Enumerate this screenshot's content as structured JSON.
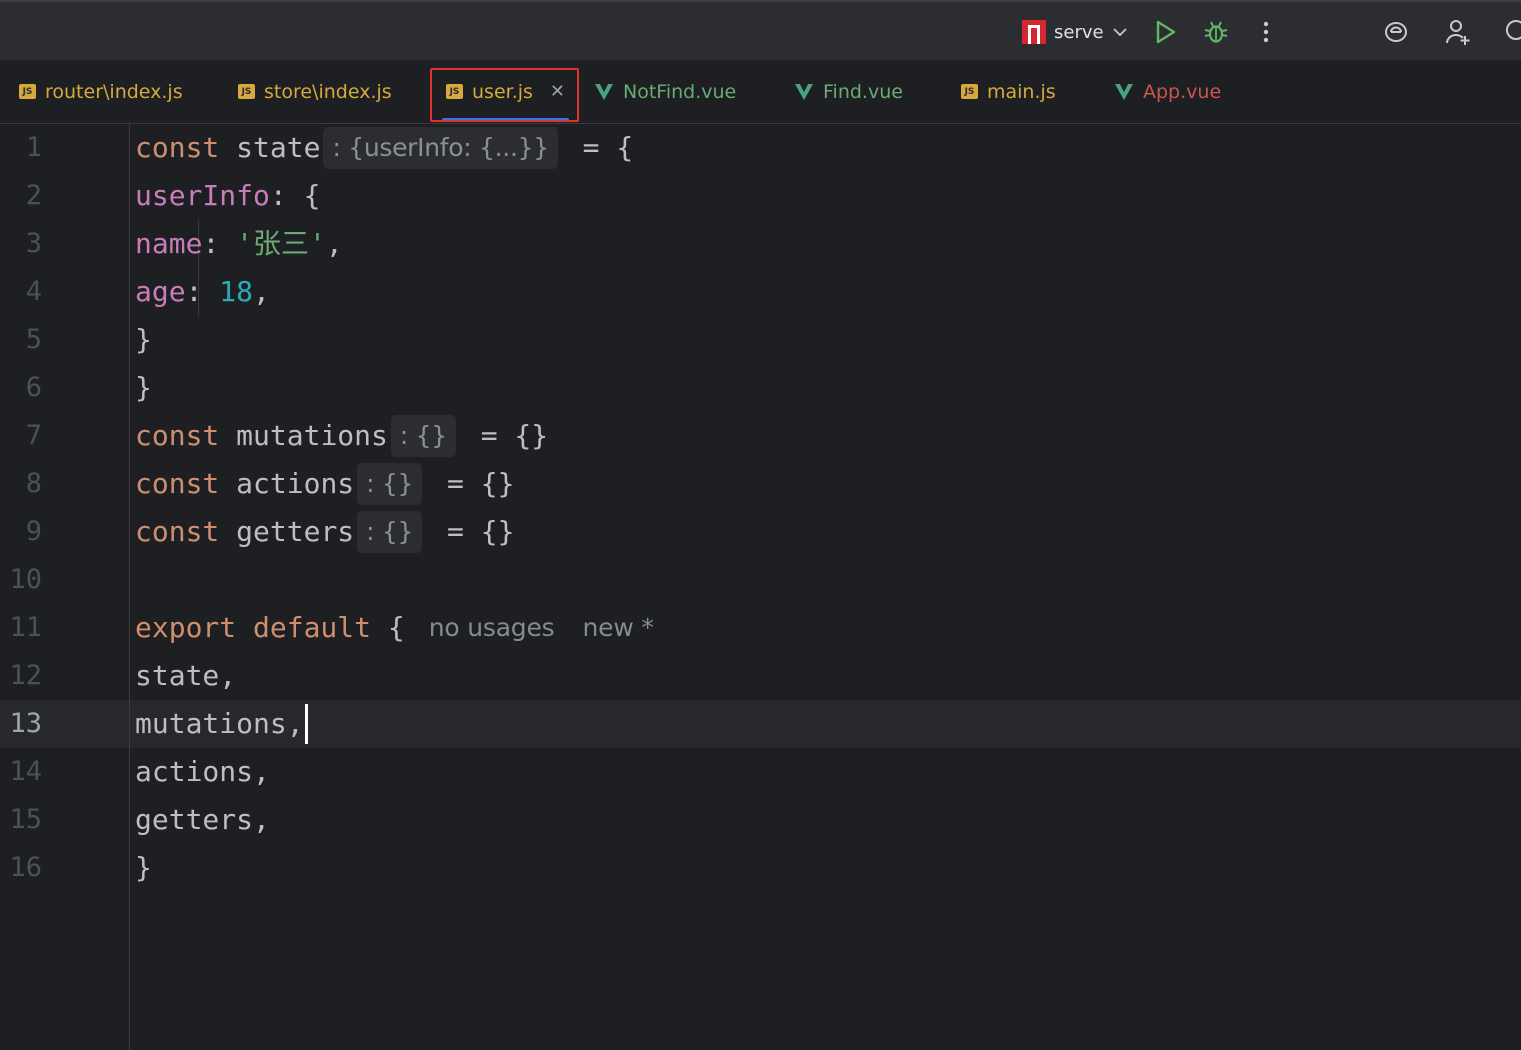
{
  "toolbar": {
    "run_config_label": "serve",
    "icons": [
      "run-config-icon",
      "chevron-down-icon",
      "run-icon",
      "debug-icon",
      "more-icon",
      "ai-assistant-icon",
      "add-user-icon",
      "search-icon"
    ],
    "colors": {
      "run": "#5fb865",
      "debug": "#5fb865",
      "config": "#d4272f"
    }
  },
  "tabs": [
    {
      "label": "router\\index.js",
      "type": "js",
      "color": "#d6a93b"
    },
    {
      "label": "store\\index.js",
      "type": "js",
      "color": "#d6a93b"
    },
    {
      "label": "user.js",
      "type": "js",
      "color": "#d6a93b",
      "active": true
    },
    {
      "label": "NotFind.vue",
      "type": "vue",
      "color": "#6aab73"
    },
    {
      "label": "Find.vue",
      "type": "vue",
      "color": "#6aab73"
    },
    {
      "label": "main.js",
      "type": "js",
      "color": "#d6a93b"
    },
    {
      "label": "App.vue",
      "type": "vue",
      "color": "#c9574b"
    }
  ],
  "editor": {
    "current_line": 13,
    "line_numbers": [
      "1",
      "2",
      "3",
      "4",
      "5",
      "6",
      "7",
      "8",
      "9",
      "10",
      "11",
      "12",
      "13",
      "14",
      "15",
      "16"
    ],
    "l1": {
      "kw": "const",
      "name": " state",
      "hint": ": {userInfo: {...}}",
      "rest": " = {"
    },
    "l2": {
      "prop": "userInfo",
      "rest": ": {"
    },
    "l3": {
      "prop": "name",
      "colon": ": ",
      "str": "'张三'",
      "rest": ","
    },
    "l4": {
      "prop": "age",
      "colon": ": ",
      "num": "18",
      "rest": ","
    },
    "l5": {
      "rest": "}"
    },
    "l6": {
      "rest": "}"
    },
    "l7": {
      "kw": "const",
      "name": " mutations",
      "hint": ": {}",
      "rest": " = {}"
    },
    "l8": {
      "kw": "const",
      "name": " actions",
      "hint": ": {}",
      "rest": " = {}"
    },
    "l9": {
      "kw": "const",
      "name": " getters",
      "hint": ": {}",
      "rest": " = {}"
    },
    "l11": {
      "kw": "export default",
      "rest": " {",
      "usages": "no usages",
      "new": "new *"
    },
    "l12": {
      "rest": "state,"
    },
    "l13": {
      "rest": "mutations,"
    },
    "l14": {
      "rest": "actions,"
    },
    "l15": {
      "rest": "getters,"
    },
    "l16": {
      "rest": "}"
    }
  },
  "colors": {
    "background": "#1e1f22",
    "keyword": "#cf8e6d",
    "property": "#c77dbb",
    "string": "#6aab73",
    "number": "#2aacb8",
    "text": "#bcbec4",
    "tab_underline": "#3574f0",
    "highlight_box": "#e0322d"
  }
}
